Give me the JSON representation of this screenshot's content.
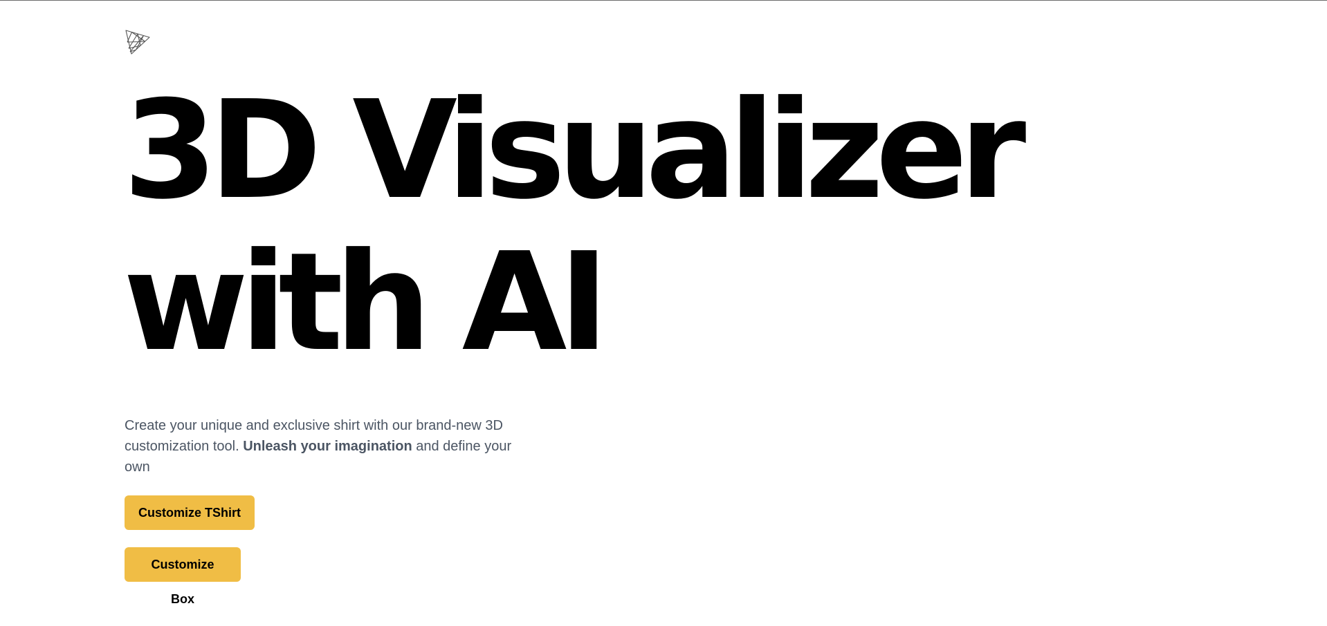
{
  "logo": {
    "icon": "threejs-triangle-logo-icon"
  },
  "hero": {
    "line1": "3D Visualizer",
    "line2": "with AI"
  },
  "description": {
    "text_before": "Create your unique and exclusive shirt with our brand-new 3D customization tool. ",
    "emphasis": "Unleash your imagination",
    "text_after": " and define your own"
  },
  "buttons": {
    "customize_tshirt": "Customize TShirt",
    "customize_box": "Customize Box"
  },
  "colors": {
    "accent": "#f0bd45",
    "body_text": "#4b5563",
    "heading": "#000000"
  }
}
